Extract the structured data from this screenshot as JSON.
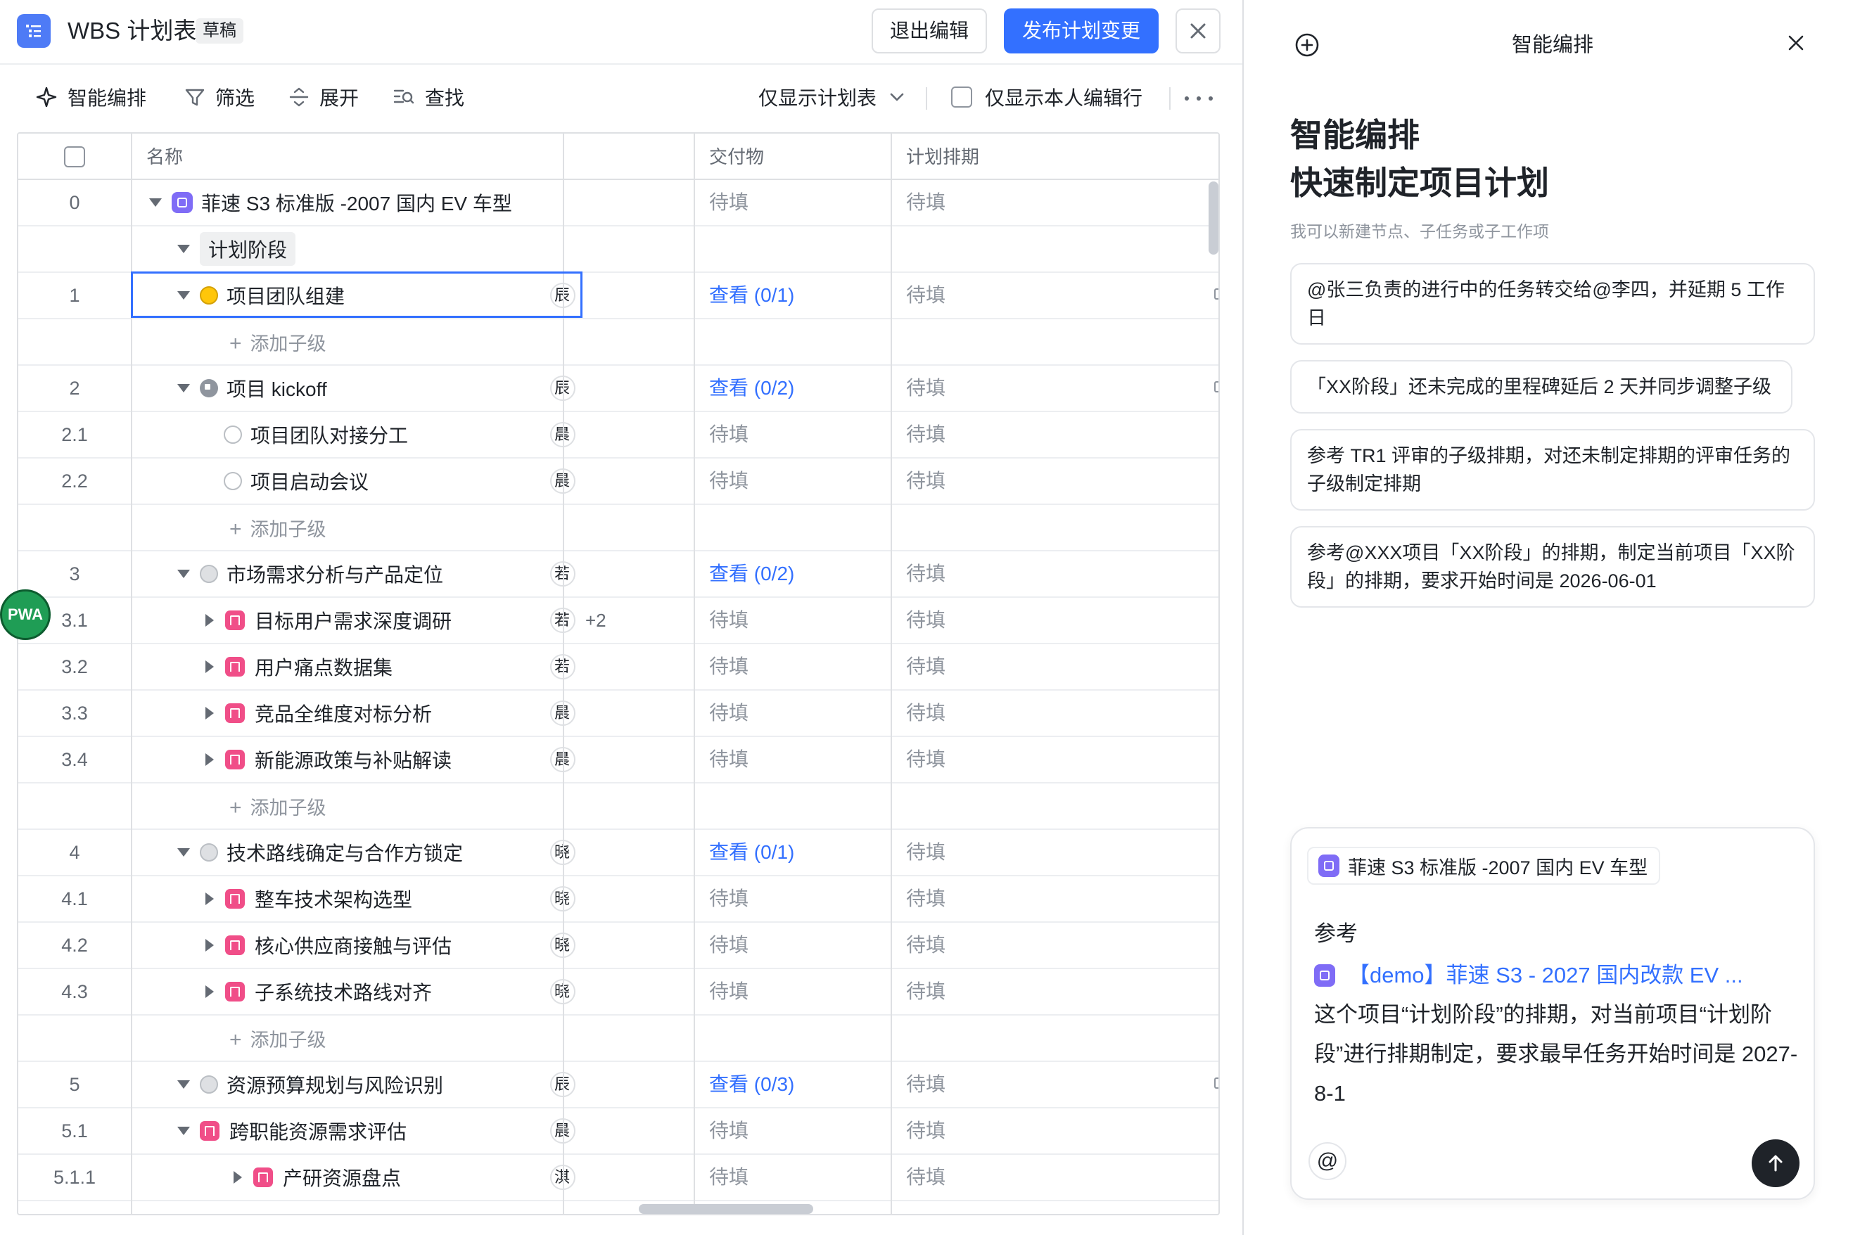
{
  "app": {
    "title": "WBS 计划表",
    "badge": "草稿"
  },
  "header_actions": {
    "exit_label": "退出编辑",
    "publish_label": "发布计划变更",
    "close_icon": "close-icon"
  },
  "toolbar": {
    "smart_label": "智能编排",
    "filter_label": "筛选",
    "expand_label": "展开",
    "find_label": "查找",
    "view_select": "仅显示计划表",
    "only_mine_label": "仅显示本人编辑行"
  },
  "columns": {
    "name": "名称",
    "deliverable": "交付物",
    "schedule": "计划排期"
  },
  "rows": [
    {
      "idx": "0",
      "name": "菲速 S3 标准版 -2007 国内 EV 车型",
      "kind": "project",
      "deliv": "待填",
      "sched": "待填"
    },
    {
      "idx": "",
      "name": "计划阶段",
      "kind": "phase",
      "deliv": "",
      "sched": ""
    },
    {
      "idx": "1",
      "name": "项目团队组建",
      "kind": "milestone-yellow",
      "owner": "辰",
      "deliv": "查看 (0/1)",
      "sched": "待填"
    },
    {
      "idx": "",
      "name": "添加子级",
      "kind": "add",
      "deliv": "",
      "sched": ""
    },
    {
      "idx": "2",
      "name": "项目 kickoff",
      "kind": "milestone-pause",
      "owner": "辰",
      "deliv": "查看 (0/2)",
      "sched": "待填"
    },
    {
      "idx": "2.1",
      "name": "项目团队对接分工",
      "kind": "subtask",
      "owner": "晨",
      "deliv": "待填",
      "sched": "待填"
    },
    {
      "idx": "2.2",
      "name": "项目启动会议",
      "kind": "subtask",
      "owner": "晨",
      "deliv": "待填",
      "sched": "待填"
    },
    {
      "idx": "",
      "name": "添加子级",
      "kind": "add",
      "deliv": "",
      "sched": ""
    },
    {
      "idx": "3",
      "name": "市场需求分析与产品定位",
      "kind": "milestone-grey",
      "owner": "若",
      "deliv": "查看 (0/2)",
      "sched": "待填"
    },
    {
      "idx": "3.1",
      "name": "目标用户需求深度调研",
      "kind": "task",
      "owner": "若",
      "owner_more": "+2",
      "deliv": "待填",
      "sched": "待填"
    },
    {
      "idx": "3.2",
      "name": "用户痛点数据集",
      "kind": "task",
      "owner": "若",
      "deliv": "待填",
      "sched": "待填"
    },
    {
      "idx": "3.3",
      "name": "竞品全维度对标分析",
      "kind": "task",
      "owner": "晨",
      "deliv": "待填",
      "sched": "待填"
    },
    {
      "idx": "3.4",
      "name": "新能源政策与补贴解读",
      "kind": "task",
      "owner": "晨",
      "deliv": "待填",
      "sched": "待填"
    },
    {
      "idx": "",
      "name": "添加子级",
      "kind": "add",
      "deliv": "",
      "sched": ""
    },
    {
      "idx": "4",
      "name": "技术路线确定与合作方锁定",
      "kind": "milestone-grey",
      "owner": "晓",
      "deliv": "查看 (0/1)",
      "sched": "待填"
    },
    {
      "idx": "4.1",
      "name": "整车技术架构选型",
      "kind": "task",
      "owner": "晓",
      "deliv": "待填",
      "sched": "待填"
    },
    {
      "idx": "4.2",
      "name": "核心供应商接触与评估",
      "kind": "task",
      "owner": "晓",
      "deliv": "待填",
      "sched": "待填"
    },
    {
      "idx": "4.3",
      "name": "子系统技术路线对齐",
      "kind": "task",
      "owner": "晓",
      "deliv": "待填",
      "sched": "待填"
    },
    {
      "idx": "",
      "name": "添加子级",
      "kind": "add",
      "deliv": "",
      "sched": ""
    },
    {
      "idx": "5",
      "name": "资源预算规划与风险识别",
      "kind": "milestone-grey",
      "owner": "辰",
      "deliv": "查看 (0/3)",
      "sched": "待填"
    },
    {
      "idx": "5.1",
      "name": "跨职能资源需求评估",
      "kind": "task-open",
      "owner": "晨",
      "deliv": "待填",
      "sched": "待填"
    },
    {
      "idx": "5.1.1",
      "name": "产研资源盘点",
      "kind": "task-deep",
      "owner": "淇",
      "deliv": "待填",
      "sched": "待填"
    }
  ],
  "floating_avatar": "PWA",
  "panel": {
    "title": "智能编排",
    "heading_line1": "智能编排",
    "heading_line2": "快速制定项目计划",
    "subtitle": "我可以新建节点、子任务或子工作项",
    "suggestions": [
      "@张三负责的进行中的任务转交给@李四，并延期 5 工作日",
      "「XX阶段」还未完成的里程碑延后 2 天并同步调整子级",
      "参考 TR1 评审的子级排期，对还未制定排期的评审任务的子级制定排期",
      "参考@XXX项目「XX阶段」的排期，制定当前项目「XX阶段」的排期，要求开始时间是 2026-06-01"
    ],
    "composer": {
      "context_chip": "菲速 S3 标准版 -2007 国内 EV 车型",
      "line_ref_label": "参考",
      "ref_project": "【demo】菲速 S3 - 2027 国内改款 EV ...",
      "body": "这个项目“计划阶段”的排期，对当前项目“计划阶段”进行排期制定，要求最早任务开始时间是 2027-8-1",
      "at_symbol": "@"
    }
  }
}
